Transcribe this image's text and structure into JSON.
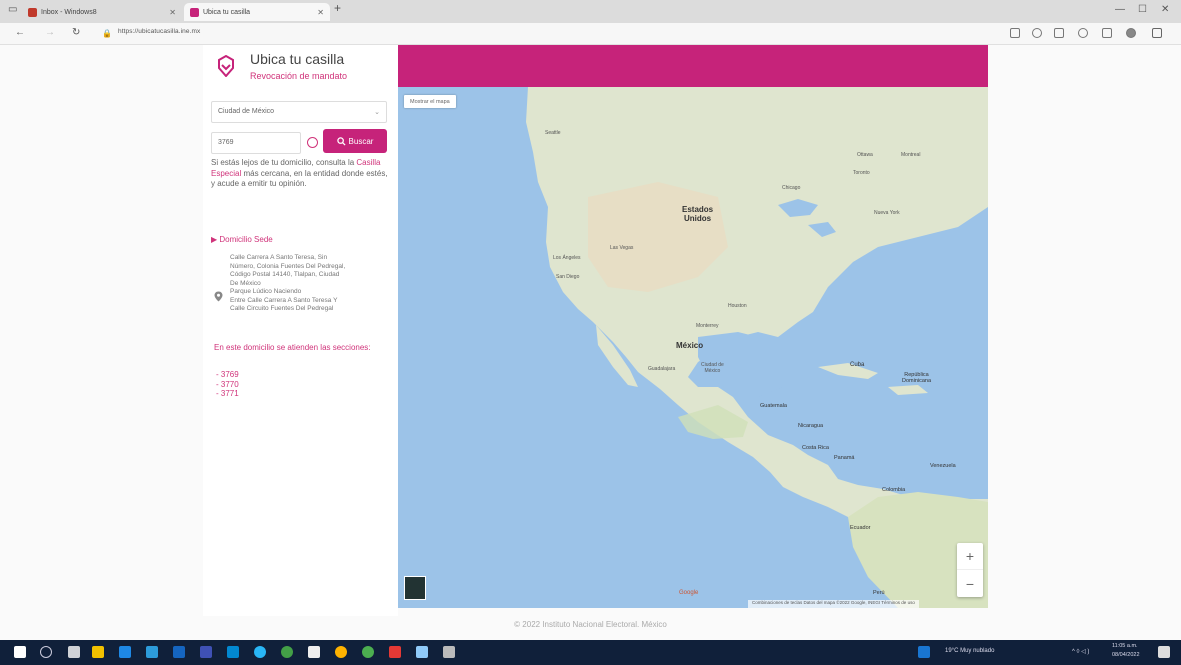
{
  "browser": {
    "tabs": [
      {
        "label": "Inbox - Windows8",
        "fav_color": "#c0392b"
      },
      {
        "label": "Ubica tu casilla",
        "fav_color": "#c6237a"
      }
    ],
    "new_tab": "+",
    "url": "https://ubicatucasilla.ine.mx",
    "window_controls": {
      "minimize": "—",
      "maximize": "☐",
      "close": "✕"
    },
    "nav": {
      "back": "←",
      "forward": "→",
      "refresh": "↻"
    }
  },
  "app": {
    "title": "Ubica tu casilla",
    "subtitle": "Revocación de mandato",
    "accent": "#c6237a",
    "state_select": {
      "value": "Ciudad de México",
      "chevron": "⌄"
    },
    "section_input": {
      "value": "3769"
    },
    "search_button": {
      "label": "Buscar",
      "icon": "🔍"
    },
    "help": {
      "before": "Si estás lejos de tu domicilio, consulta la ",
      "link": "Casilla Especial",
      "after": " más cercana, en la entidad donde estés, y acude a emitir tu opinión."
    },
    "domicilio_heading": "▶ Domicilio Sede",
    "address_lines": [
      "Calle Carrera A Santo Teresa, Sin",
      "Número, Colonia Fuentes Del Pedregal,",
      "Código Postal 14140, Tlalpan, Ciudad",
      "De México",
      "Parque Lúdico Naciendo",
      "Entre Calle Carrera A Santo Teresa Y",
      "Calle Circuito Fuentes Del Pedregal"
    ],
    "sections_note": "En este domicilio se atienden las secciones:",
    "sections": [
      "- 3769",
      "- 3770",
      "- 3771"
    ],
    "footer": "© 2022 Instituto Nacional Electoral. México"
  },
  "map": {
    "type_button": "Mostrar el mapa",
    "zoom_in": "+",
    "zoom_out": "−",
    "google": "Google",
    "attribution": "Combinaciones de teclas   Datos del mapa ©2022 Google, INEGI   Términos de uso",
    "labels": {
      "estados_unidos": "Estados\nUnidos",
      "mexico": "México",
      "cuba": "Cuba",
      "rep_dom": "República\nDominicana",
      "guatemala": "Guatemala",
      "nicaragua": "Nicaragua",
      "costa_rica": "Costa Rica",
      "panama": "Panamá",
      "venezuela": "Venezuela",
      "colombia": "Colombia",
      "ecuador": "Ecuador",
      "peru": "Perú",
      "seattle": "Seattle",
      "los_angeles": "Los Ángeles",
      "san_diego": "San Diego",
      "las_vegas": "Las Vegas",
      "chicago": "Chicago",
      "toronto": "Toronto",
      "ottawa": "Ottawa",
      "montreal": "Montreal",
      "new_york": "Nueva York",
      "houston": "Houston",
      "monterrey": "Monterrey",
      "guadalajara": "Guadalajara",
      "cdmx": "Ciudad de\nMéxico"
    }
  },
  "taskbar": {
    "weather": "19°C Muy nublado",
    "time": "11:05 a.m.",
    "date": "08/04/2022"
  }
}
